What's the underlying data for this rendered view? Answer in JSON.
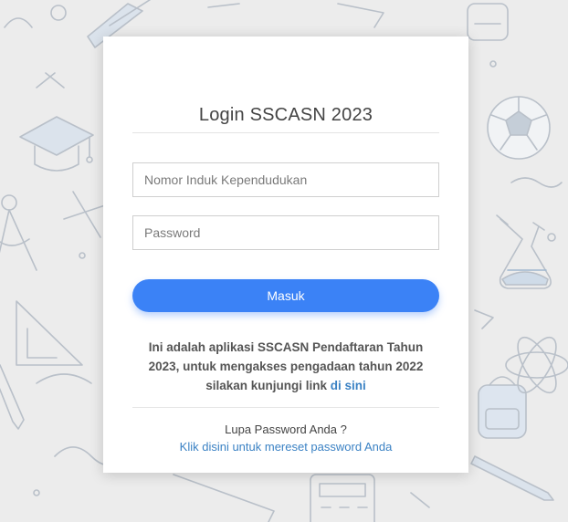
{
  "login": {
    "title": "Login SSCASN 2023",
    "nik_placeholder": "Nomor Induk Kependudukan",
    "password_placeholder": "Password",
    "submit_label": "Masuk"
  },
  "info": {
    "text_line1": "Ini adalah aplikasi SSCASN Pendaftaran Tahun",
    "text_line2": "2023, untuk mengakses pengadaan tahun 2022",
    "text_line3_prefix": "silakan kunjungi link",
    "link_label": "di sini"
  },
  "forgot": {
    "question": "Lupa Password Anda ?",
    "reset_link_label": "Klik disini untuk mereset password Anda"
  },
  "colors": {
    "accent": "#3b82f6",
    "link": "#3b82c4",
    "background": "#ececec"
  },
  "icons": [
    "graduation-cap-icon",
    "soccer-ball-icon",
    "flask-icon",
    "backpack-icon",
    "compass-icon",
    "protractor-icon",
    "pencil-icon",
    "pen-icon",
    "atom-icon",
    "calculator-icon"
  ]
}
